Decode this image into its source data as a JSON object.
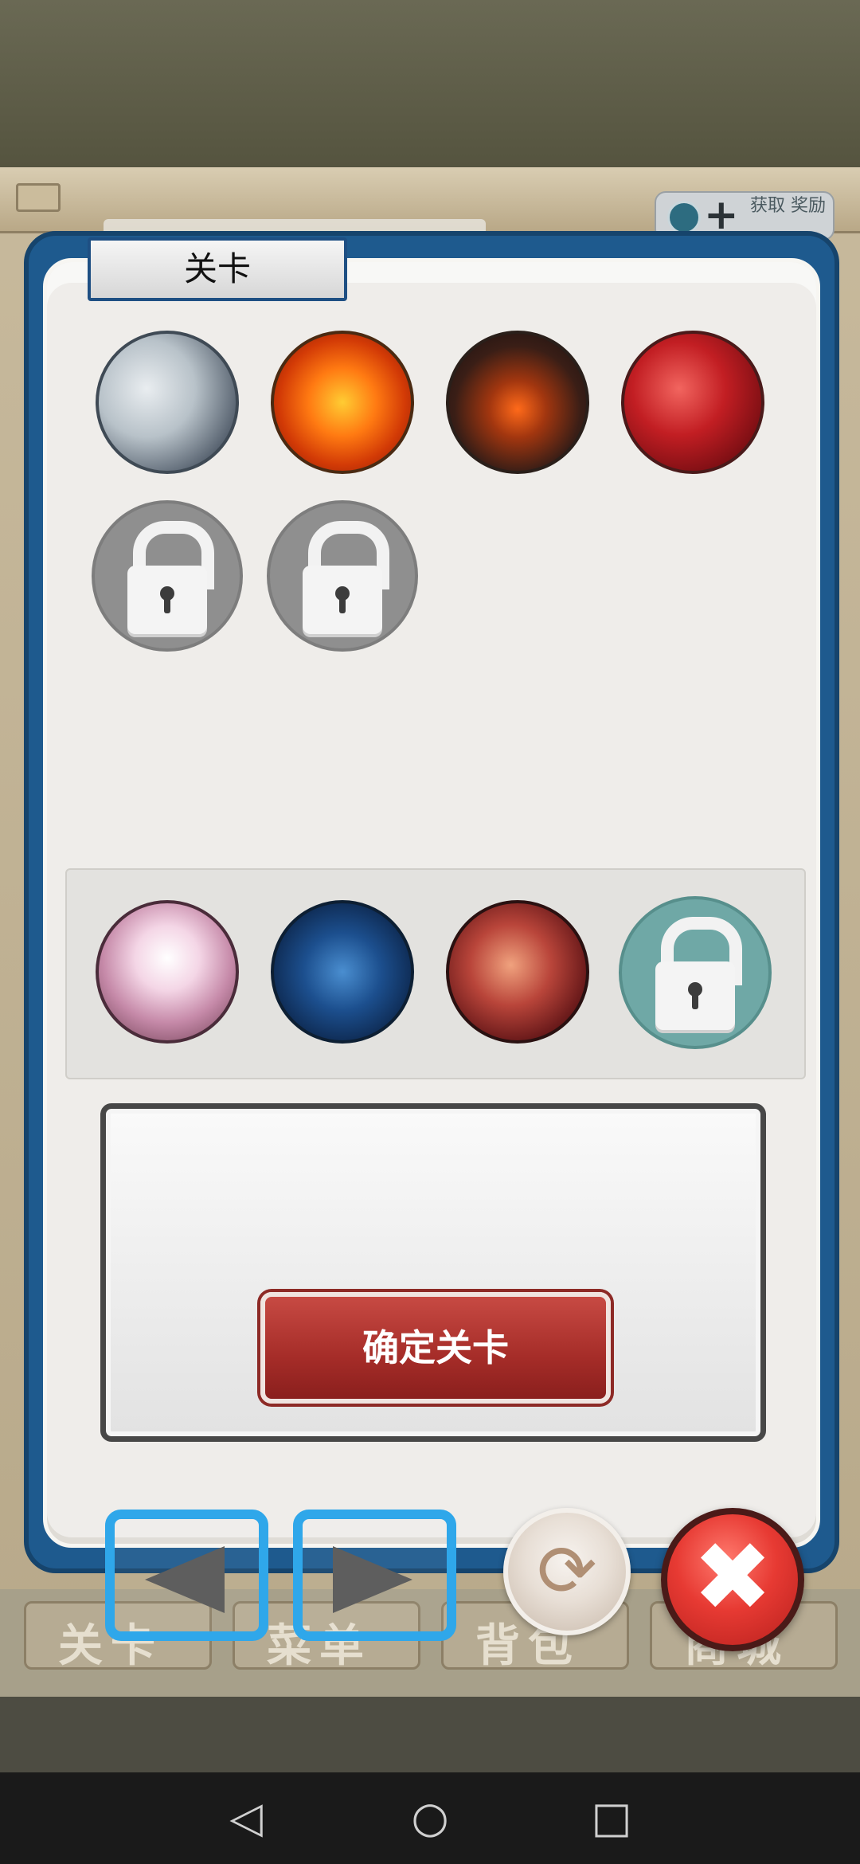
{
  "header": {
    "get_badge_text": "获取\n奖励"
  },
  "background_tabs": [
    "关卡",
    "菜单",
    "背包",
    "商城"
  ],
  "panel": {
    "title": "关卡",
    "confirm_label": "确定关卡"
  },
  "stages_row1": [
    {
      "name": "stage-mist-castle",
      "locked": false
    },
    {
      "name": "stage-lava",
      "locked": false
    },
    {
      "name": "stage-demon-gate",
      "locked": false
    },
    {
      "name": "stage-crimson",
      "locked": false
    },
    {
      "name": "stage-locked-5",
      "locked": true
    },
    {
      "name": "stage-locked-6",
      "locked": true
    }
  ],
  "stages_row2": [
    {
      "name": "stage-pink-hall",
      "locked": false
    },
    {
      "name": "stage-ice-cave",
      "locked": false
    },
    {
      "name": "stage-chain-inferno",
      "locked": false
    },
    {
      "name": "stage-locked-teal",
      "locked": true
    }
  ],
  "controls": {
    "prev_icon": "left-arrow-icon",
    "next_icon": "right-arrow-icon",
    "refresh_icon": "refresh-icon",
    "close_icon": "close-icon",
    "refresh_glyph": "⟳",
    "close_glyph": "✖"
  },
  "nav": {
    "back_glyph": "◁",
    "home_glyph": "○",
    "recent_glyph": "□"
  },
  "colors": {
    "panel_blue": "#1e5a8e",
    "confirm_red": "#a52c28",
    "arrow_blue": "#2fa7ea",
    "close_red": "#e73a33"
  }
}
